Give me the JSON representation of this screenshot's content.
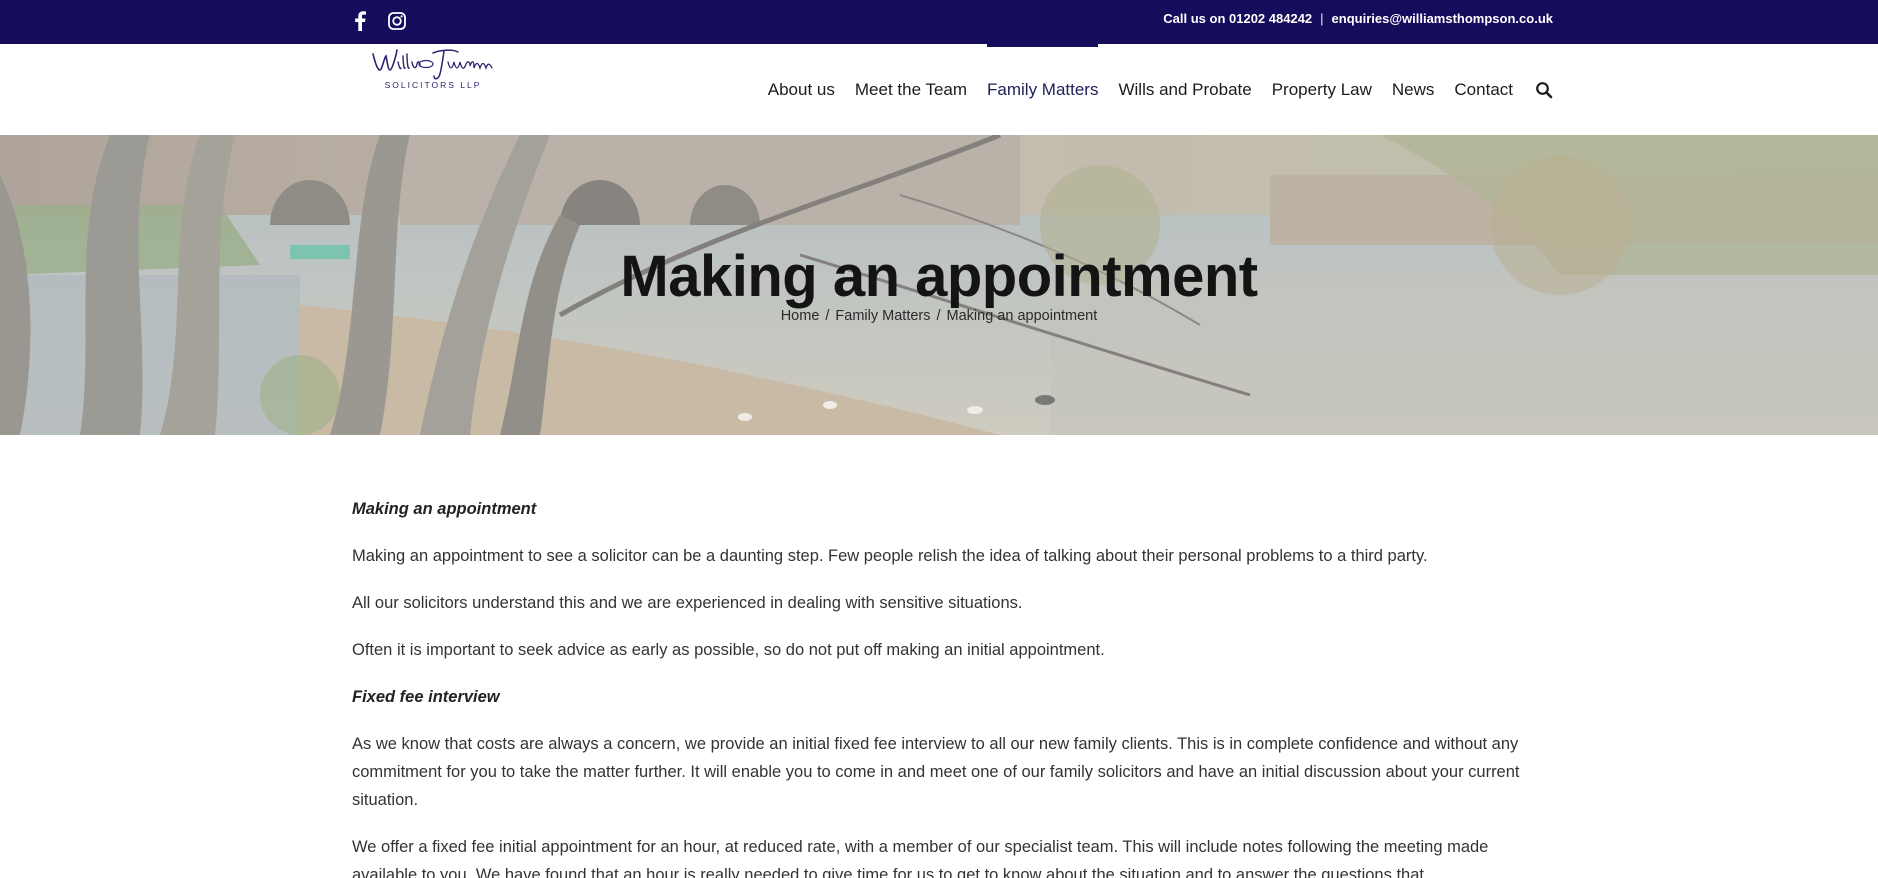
{
  "topbar": {
    "social": [
      {
        "name": "facebook-icon"
      },
      {
        "name": "instagram-icon"
      }
    ],
    "phone_label": "Call us on 01202 484242",
    "separator": "|",
    "email": "enquiries@williamsthompson.co.uk",
    "bg_color": "#160c5c"
  },
  "header": {
    "logo": {
      "script_text": "William Thompson",
      "sub_text": "SOLICITORS LLP"
    },
    "nav": [
      {
        "label": "About us"
      },
      {
        "label": "Meet the Team"
      },
      {
        "label": "Family Matters",
        "active": true
      },
      {
        "label": "Wills and Probate"
      },
      {
        "label": "Property Law"
      },
      {
        "label": "News"
      },
      {
        "label": "Contact"
      }
    ],
    "search_icon": "search-icon"
  },
  "hero": {
    "title": "Making an appointment",
    "breadcrumb": {
      "home": "Home",
      "separator": "/",
      "parent": "Family Matters",
      "current": "Making an appointment"
    }
  },
  "content": {
    "paragraphs": [
      {
        "type": "heading",
        "text": "Making an appointment"
      },
      {
        "type": "text",
        "text": "Making an appointment to see a solicitor can be a daunting step.  Few people relish the idea of talking about their personal problems to a third party."
      },
      {
        "type": "text",
        "text": "All our solicitors understand this and we are experienced in dealing with sensitive situations."
      },
      {
        "type": "text",
        "text": "Often it is important to seek advice as early as possible, so do not put off making an initial appointment."
      },
      {
        "type": "heading",
        "text": "Fixed fee interview"
      },
      {
        "type": "text",
        "text": "As we know that costs are always a concern, we provide an initial fixed fee interview to all our new family clients.  This is in complete confidence and without any commitment for you to take the matter further.  It will enable you to come in and meet one of our family solicitors and have an initial discussion about your current situation."
      },
      {
        "type": "text",
        "text": "We offer a fixed fee initial appointment for an hour, at reduced rate, with a member of our specialist team.  This will include notes following the meeting made available to you.  We have found that an hour is really needed to give time for us to get to know about the situation and to answer the questions that"
      }
    ]
  }
}
